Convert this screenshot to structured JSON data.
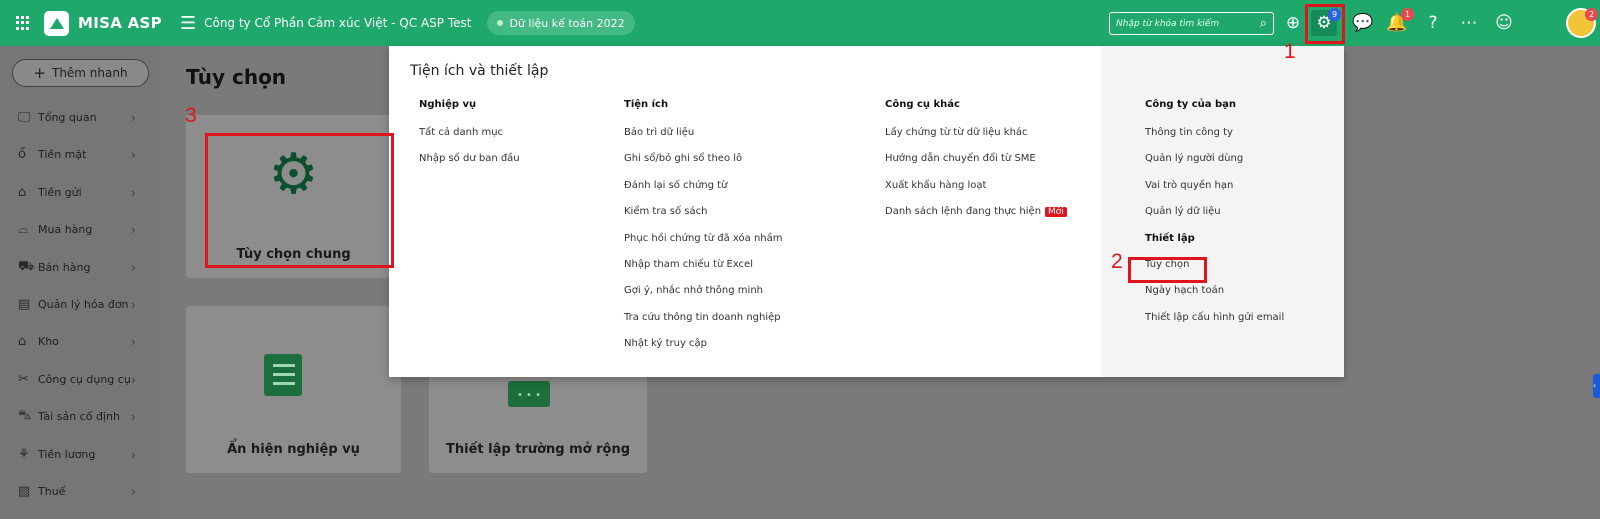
{
  "app": {
    "name": "MISA ASP",
    "company": "Công ty Cổ Phần Cảm xúc Việt - QC ASP Test",
    "data_badge": "Dữ liệu kế toán 2022"
  },
  "search": {
    "placeholder": "Nhập từ khóa tìm kiếm"
  },
  "topbar": {
    "settings_badge": "9",
    "notifications_badge": "1",
    "avatar_badge": "2"
  },
  "steps": {
    "one": "1",
    "two": "2",
    "three": "3"
  },
  "sidebar": {
    "add_button": "Thêm nhanh",
    "items": [
      {
        "label": "Tổng quan",
        "icon": "monitor-icon"
      },
      {
        "label": "Tiền mặt",
        "icon": "money-bag-icon"
      },
      {
        "label": "Tiền gửi",
        "icon": "bank-icon"
      },
      {
        "label": "Mua hàng",
        "icon": "shopping-bag-icon"
      },
      {
        "label": "Bán hàng",
        "icon": "cart-icon"
      },
      {
        "label": "Quản lý hóa đơn",
        "icon": "invoice-icon"
      },
      {
        "label": "Kho",
        "icon": "warehouse-icon"
      },
      {
        "label": "Công cụ dụng cụ",
        "icon": "tools-icon"
      },
      {
        "label": "Tài sản cố định",
        "icon": "car-icon"
      },
      {
        "label": "Tiền lương",
        "icon": "salary-icon"
      },
      {
        "label": "Thuế",
        "icon": "tax-icon"
      }
    ]
  },
  "page": {
    "title": "Tùy chọn",
    "cards": [
      {
        "label": "Tùy chọn chung",
        "icon": "gear-icon"
      },
      {
        "label": "Ẩn hiện nghiệp vụ",
        "icon": "checklist-icon"
      },
      {
        "label": "Thiết lập trường mở rộng",
        "icon": "extend-icon"
      }
    ]
  },
  "dropdown": {
    "title": "Tiện ích và thiết lập",
    "columns": [
      {
        "heading": "Nghiệp vụ",
        "items": [
          "Tất cả danh mục",
          "Nhập số dư ban đầu"
        ]
      },
      {
        "heading": "Tiện ích",
        "items": [
          "Bảo trì dữ liệu",
          "Ghi sổ/bỏ ghi sổ theo lô",
          "Đánh lại số chứng từ",
          "Kiểm tra số sách",
          "Phục hồi chứng từ đã xóa nhầm",
          "Nhập tham chiếu từ Excel",
          "Gợi ý, nhắc nhở thông minh",
          "Tra cứu thông tin doanh nghiệp",
          "Nhật ký truy cập"
        ]
      },
      {
        "heading": "Công cụ khác",
        "items": [
          "Lấy chứng từ từ dữ liệu khác",
          "Hướng dẫn chuyển đổi từ SME",
          "Xuất khẩu hàng loạt",
          "Danh sách lệnh đang thực hiện"
        ],
        "new_tag": "Mới"
      },
      {
        "heading": "Công ty của bạn",
        "items": [
          "Thông tin công ty",
          "Quản lý người dùng",
          "Vai trò quyền hạn",
          "Quản lý dữ liệu"
        ],
        "subheading": "Thiết lập",
        "sub_items": [
          "Tùy chọn",
          "Ngày hạch toán",
          "Thiết lập cấu hình gửi email"
        ]
      }
    ]
  },
  "colors": {
    "brand": "#1fa86b",
    "highlight": "#e1141d",
    "new_tag": "#e1141d"
  }
}
